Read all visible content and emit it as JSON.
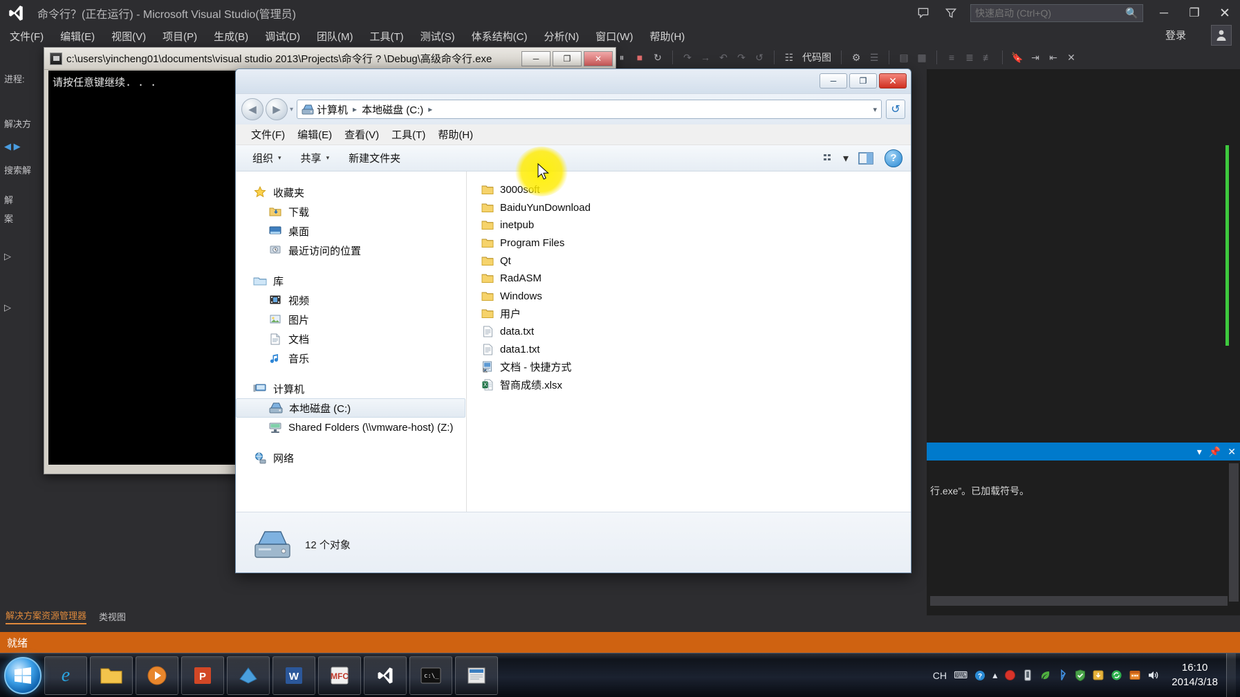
{
  "vs": {
    "title": "命令行？(正在运行) - Microsoft Visual Studio(管理员)",
    "logo_icon": "visual-studio-logo-icon",
    "quick_launch": {
      "placeholder": "快速启动 (Ctrl+Q)",
      "value": "",
      "icon": "search-icon"
    },
    "feedback_icon": "feedback-icon",
    "filter_icon": "filter-icon",
    "window_controls": {
      "minimize": "─",
      "maximize": "❐",
      "close": "✕"
    },
    "signin_label": "登录",
    "user_icon": "user-badge-icon",
    "menu": [
      "文件(F)",
      "编辑(E)",
      "视图(V)",
      "项目(P)",
      "生成(B)",
      "调试(D)",
      "团队(M)",
      "工具(T)",
      "测试(S)",
      "体系结构(C)",
      "分析(N)",
      "窗口(W)",
      "帮助(H)"
    ],
    "toolbar": {
      "pause_icon": "pause-icon",
      "stop_icon": "stop-icon",
      "restart_icon": "restart-icon",
      "step_into_icon": "step-into-icon",
      "step_over_icon": "step-over-icon",
      "step_out_icon": "step-out-icon",
      "codemap_icon": "code-map-icon",
      "codemap_label": "代码图",
      "thread_icon": "thread-icon",
      "bookmark_icon": "bookmark-icon",
      "indent_icon": "indent-icon",
      "comment_icon": "comment-icon"
    },
    "left_panel": {
      "rows": [
        "进程:",
        "解决方",
        "搜索解",
        "解",
        "案"
      ],
      "tabs": [
        {
          "label": "解决方案资源管理器",
          "active": true
        },
        {
          "label": "类视图",
          "active": false
        }
      ]
    },
    "output": {
      "pin_icon": "pin-icon",
      "dropdown_icon": "chevron-down-icon",
      "close_icon": "close-icon",
      "text": "行.exe”。已加载符号。"
    },
    "statusbar": {
      "text": "就绪"
    }
  },
  "console": {
    "title": "c:\\users\\yincheng01\\documents\\visual studio 2013\\Projects\\命令行 ? \\Debug\\高级命令行.exe",
    "icon": "console-icon",
    "window_controls": {
      "minimize": "─",
      "maximize": "❐",
      "close": "✕"
    },
    "body_lines": [
      "请按任意键继续. . ."
    ]
  },
  "explorer": {
    "window_controls": {
      "minimize": "─",
      "maximize": "❐",
      "close": "✕"
    },
    "nav": {
      "back_icon": "back-arrow-icon",
      "forward_icon": "forward-arrow-icon",
      "history_icon": "chevron-down-icon",
      "refresh_icon": "refresh-icon"
    },
    "address": {
      "icon": "drive-icon",
      "crumbs": [
        "计算机",
        "本地磁盘 (C:)"
      ],
      "separator": "▸",
      "dropdown_icon": "chevron-down-icon"
    },
    "menu": [
      "文件(F)",
      "编辑(E)",
      "查看(V)",
      "工具(T)",
      "帮助(H)"
    ],
    "toolbar": {
      "organize": "组织",
      "share": "共享",
      "new_folder": "新建文件夹",
      "caret": "▾",
      "view_icon": "view-mode-icon",
      "view_caret": "▾",
      "preview_icon": "preview-pane-icon",
      "help_icon": "help-icon",
      "help_glyph": "?"
    },
    "sidebar": [
      {
        "label": "收藏夹",
        "icon": "star-icon",
        "level": 0,
        "selected": false
      },
      {
        "label": "下载",
        "icon": "downloads-folder-icon",
        "level": 1,
        "selected": false
      },
      {
        "label": "桌面",
        "icon": "desktop-icon",
        "level": 1,
        "selected": false
      },
      {
        "label": "最近访问的位置",
        "icon": "recent-places-icon",
        "level": 1,
        "selected": false
      },
      {
        "label": "库",
        "icon": "library-icon",
        "level": 0,
        "selected": false
      },
      {
        "label": "视频",
        "icon": "video-icon",
        "level": 1,
        "selected": false
      },
      {
        "label": "图片",
        "icon": "pictures-icon",
        "level": 1,
        "selected": false
      },
      {
        "label": "文档",
        "icon": "documents-icon",
        "level": 1,
        "selected": false
      },
      {
        "label": "音乐",
        "icon": "music-icon",
        "level": 1,
        "selected": false
      },
      {
        "label": "计算机",
        "icon": "computer-icon",
        "level": 0,
        "selected": false
      },
      {
        "label": "本地磁盘 (C:)",
        "icon": "drive-icon",
        "level": 1,
        "selected": true
      },
      {
        "label": "Shared Folders (\\\\vmware-host) (Z:)",
        "icon": "network-drive-icon",
        "level": 1,
        "selected": false
      },
      {
        "label": "网络",
        "icon": "network-icon",
        "level": 0,
        "selected": false
      }
    ],
    "files": [
      {
        "name": "3000soft",
        "icon": "folder-icon"
      },
      {
        "name": "BaiduYunDownload",
        "icon": "folder-icon"
      },
      {
        "name": "inetpub",
        "icon": "folder-icon"
      },
      {
        "name": "Program Files",
        "icon": "folder-icon"
      },
      {
        "name": "Qt",
        "icon": "folder-icon"
      },
      {
        "name": "RadASM",
        "icon": "folder-icon"
      },
      {
        "name": "Windows",
        "icon": "folder-icon"
      },
      {
        "name": "用户",
        "icon": "folder-icon"
      },
      {
        "name": "data.txt",
        "icon": "text-file-icon"
      },
      {
        "name": "data1.txt",
        "icon": "text-file-icon"
      },
      {
        "name": "文档 - 快捷方式",
        "icon": "shortcut-icon"
      },
      {
        "name": "智商成绩.xlsx",
        "icon": "excel-file-icon"
      }
    ],
    "details": {
      "icon": "drive-large-icon",
      "text": "12 个对象"
    },
    "resize_grip": "resize-grip-icon"
  },
  "taskbar": {
    "start_icon": "windows-start-orb-icon",
    "apps": [
      {
        "name": "internet-explorer",
        "glyph": "e",
        "color": "#2e9be0",
        "pinned": true
      },
      {
        "name": "windows-explorer",
        "glyph": "📁",
        "color": "#f2c04b",
        "pinned": true
      },
      {
        "name": "windows-media-player",
        "glyph": "▶",
        "color": "#e8862c",
        "pinned": true
      },
      {
        "name": "powerpoint",
        "glyph": "P",
        "color": "#d24726",
        "pinned": true
      },
      {
        "name": "blue-app",
        "glyph": "◆",
        "color": "#3c8ed4",
        "pinned": true
      },
      {
        "name": "word",
        "glyph": "W",
        "color": "#2b579a",
        "pinned": true
      },
      {
        "name": "mfc-app",
        "glyph": "M",
        "color": "#c0392b",
        "pinned": true
      },
      {
        "name": "visual-studio",
        "glyph": "⋈",
        "color": "#68217a",
        "pinned": true
      },
      {
        "name": "command-prompt",
        "glyph": "c:\\_",
        "color": "#111111",
        "pinned": true
      },
      {
        "name": "notepad-app",
        "glyph": "▤",
        "color": "#cccccc",
        "pinned": true
      }
    ],
    "tray": {
      "ime_label": "CH",
      "keyboard_icon": "keyboard-icon",
      "help_icon": "help-icon",
      "chevron_icon": "show-hidden-icons-icon",
      "record_icon": "record-icon",
      "device_icon": "device-icon",
      "leaf_icon": "leaf-icon",
      "bluetooth_icon": "bluetooth-icon",
      "security_icon": "security-icon",
      "update_icon": "update-icon",
      "sync_icon": "sync-icon",
      "battery_icon": "battery-icon",
      "volume_icon": "volume-icon",
      "antivirus_icon": "antivirus-icon",
      "calendar_icon": "calendar-icon"
    },
    "clock": {
      "time": "16:10",
      "date": "2014/3/18"
    }
  },
  "colors": {
    "vs_chrome": "#2d2d30",
    "vs_status": "#cf6211",
    "vs_accent": "#007acc",
    "explorer_chrome": "#e2eaf3",
    "folder_yellow": "#f6d36b",
    "taskbar": "#10141c"
  }
}
